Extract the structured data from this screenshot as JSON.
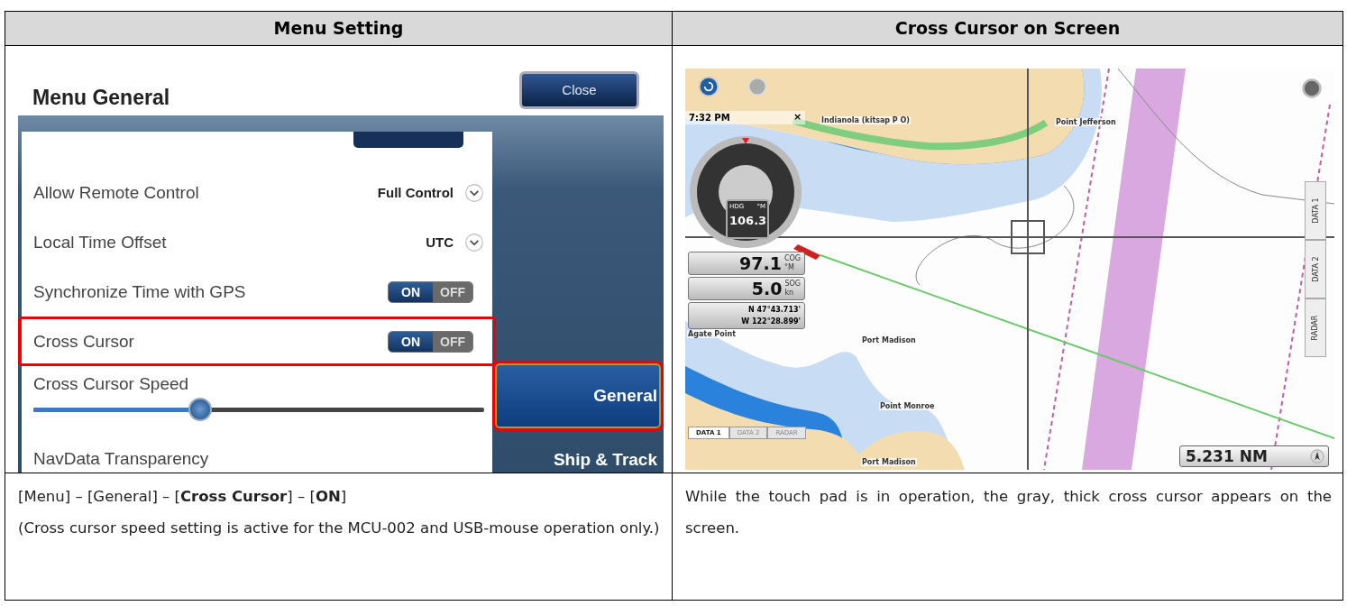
{
  "table": {
    "columns": [
      {
        "label": "Menu Setting"
      },
      {
        "label": "Cross Cursor on Screen"
      }
    ]
  },
  "menu_screen": {
    "title": "Menu General",
    "close_button": "Close",
    "rows": [
      {
        "kind": "dropdown",
        "label": "Allow Remote Control",
        "value": "Full Control",
        "highlighted": false
      },
      {
        "kind": "dropdown",
        "label": "Local Time Offset",
        "value": "UTC",
        "highlighted": false
      },
      {
        "kind": "toggle",
        "label": "Synchronize Time with GPS",
        "on_label": "ON",
        "off_label": "OFF",
        "on": true,
        "highlighted": false
      },
      {
        "kind": "toggle",
        "label": "Cross Cursor",
        "on_label": "ON",
        "off_label": "OFF",
        "on": true,
        "highlighted": true
      },
      {
        "kind": "slider",
        "label": "Cross Cursor Speed",
        "level": 0.37,
        "highlighted": false
      },
      {
        "kind": "label",
        "label": "NavData Transparency",
        "highlighted": false
      }
    ],
    "sidebar": [
      {
        "label": "General",
        "selected": true,
        "highlighted": true
      },
      {
        "label": "Ship & Track",
        "selected": false,
        "highlighted": false
      }
    ]
  },
  "chart_screen": {
    "clock": "7:32 PM",
    "close": "×",
    "places": [
      {
        "label": "Indianola (kitsap P O)"
      },
      {
        "label": "Point Jefferson"
      },
      {
        "label": "Agate Point"
      },
      {
        "label": "Port Madison"
      },
      {
        "label": "Point Monroe"
      },
      {
        "label": "Port Madison"
      }
    ],
    "heading": {
      "label": "HDG",
      "unit": "°M",
      "value": "106.3"
    },
    "readouts": [
      {
        "kind": "value",
        "value": "97.1",
        "label": "COG",
        "unit": "°M"
      },
      {
        "kind": "value",
        "value": "5.0",
        "label": "SOG",
        "unit": "kn"
      },
      {
        "kind": "position",
        "lines": [
          "N 47°43.713'",
          "W 122°28.899'"
        ]
      }
    ],
    "bottom_tabs": [
      {
        "label": "DATA 1",
        "selected": true
      },
      {
        "label": "DATA 2",
        "selected": false
      },
      {
        "label": "RADAR",
        "selected": false
      }
    ],
    "side_tabs": [
      {
        "label": "DATA 1",
        "selected": false
      },
      {
        "label": "DATA 2",
        "selected": false
      },
      {
        "label": "RADAR",
        "selected": false
      }
    ],
    "distance": "5.231 NM"
  },
  "captions": [
    {
      "paragraphs": [
        "[Menu] – [General] – [**Cross Cursor**] – [**ON**]",
        "(Cross cursor speed setting is active for the MCU-002 and USB-mouse operation only.)"
      ]
    },
    {
      "paragraphs": [
        "While the touch pad is in operation, the gray, thick cross cursor appears on the screen."
      ]
    }
  ]
}
